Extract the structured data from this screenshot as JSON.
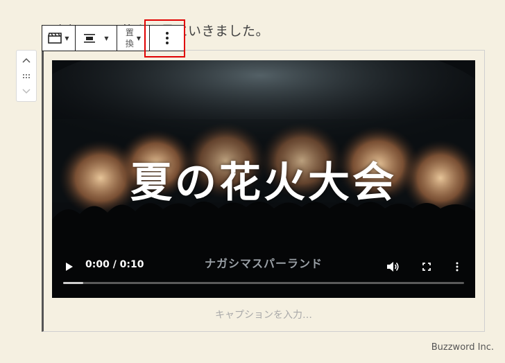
{
  "paragraph": {
    "text": "昨年の夏に花火を見にいきました。"
  },
  "toolbar": {
    "video_icon": "clapperboard-icon",
    "align_icon": "align-center-icon",
    "replace_label_line1": "置",
    "replace_label_line2": "換",
    "more_icon": "more-vertical-icon"
  },
  "mover": {
    "up_icon": "chevron-up-icon",
    "drag_icon": "drag-handle-icon",
    "down_icon": "chevron-down-icon"
  },
  "video": {
    "title": "夏の花火大会",
    "subtitle": "ナガシマスパーランド",
    "time": "0:00 / 0:10",
    "progress_fraction": 0.05
  },
  "caption": {
    "placeholder": "キャプションを入力…"
  },
  "brand": "Buzzword Inc.",
  "colors": {
    "highlight": "#e00000",
    "background": "#f5f0e1"
  }
}
